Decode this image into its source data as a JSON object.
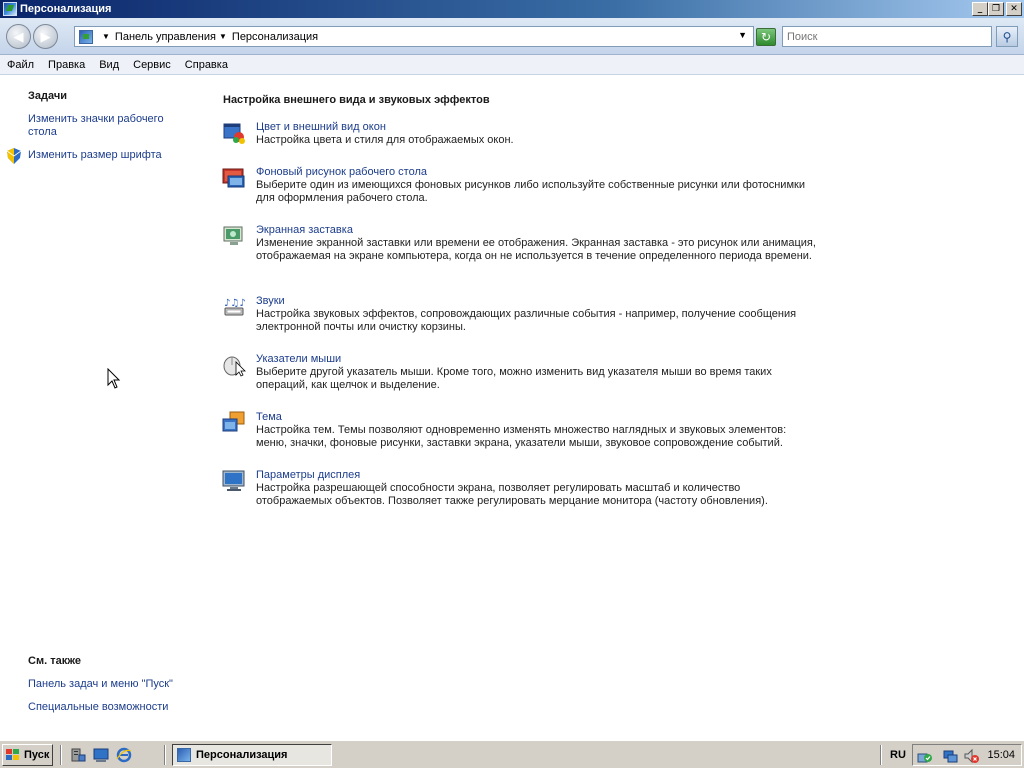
{
  "window": {
    "title": "Персонализация",
    "minimize_label": "_",
    "restore_label": "❐",
    "close_label": "✕"
  },
  "address": {
    "breadcrumb": [
      "Панель управления",
      "Персонализация"
    ],
    "search_placeholder": "Поиск",
    "refresh_icon": "refresh-icon",
    "search_icon": "search-icon"
  },
  "menu": {
    "items": [
      "Файл",
      "Правка",
      "Вид",
      "Сервис",
      "Справка"
    ]
  },
  "sidebar": {
    "tasks_heading": "Задачи",
    "tasks": [
      {
        "label": "Изменить значки рабочего стола",
        "icon": ""
      },
      {
        "label": "Изменить размер шрифта",
        "icon": "shield-icon"
      }
    ],
    "see_also_heading": "См. также",
    "see_also": [
      {
        "label": "Панель задач и меню \"Пуск\""
      },
      {
        "label": "Специальные возможности"
      }
    ]
  },
  "main": {
    "heading": "Настройка внешнего вида и звуковых эффектов",
    "items": [
      {
        "title": "Цвет и внешний вид окон",
        "description": "Настройка цвета и стиля для отображаемых окон.",
        "icon": "window-color-icon"
      },
      {
        "title": "Фоновый рисунок рабочего стола",
        "description": "Выберите один из имеющихся фоновых рисунков либо используйте собственные рисунки или фотоснимки для оформления рабочего стола.",
        "icon": "desktop-background-icon"
      },
      {
        "title": "Экранная заставка",
        "description": "Изменение экранной заставки или времени ее отображения. Экранная заставка - это рисунок или анимация, отображаемая на экране компьютера, когда он не используется в течение определенного периода времени.",
        "icon": "screensaver-icon"
      },
      {
        "title": "Звуки",
        "description": "Настройка звуковых эффектов, сопровождающих различные события - например, получение сообщения электронной почты или очистку корзины.",
        "icon": "sounds-icon"
      },
      {
        "title": "Указатели мыши",
        "description": "Выберите другой указатель мыши. Кроме того, можно изменить вид указателя мыши во время таких операций, как щелчок и выделение.",
        "icon": "mouse-pointer-icon"
      },
      {
        "title": "Тема",
        "description": "Настройка тем. Темы позволяют одновременно изменять множество наглядных и звуковых элементов: меню, значки, фоновые рисунки, заставки экрана, указатели мыши, звуковое сопровождение событий.",
        "icon": "theme-icon"
      },
      {
        "title": "Параметры дисплея",
        "description": "Настройка разрешающей способности экрана, позволяет регулировать масштаб и количество отображаемых объектов. Позволяет также регулировать мерцание монитора (частоту обновления).",
        "icon": "display-settings-icon"
      }
    ]
  },
  "taskbar": {
    "start_label": "Пуск",
    "active_window": "Персонализация",
    "language": "RU",
    "clock": "15:04"
  }
}
